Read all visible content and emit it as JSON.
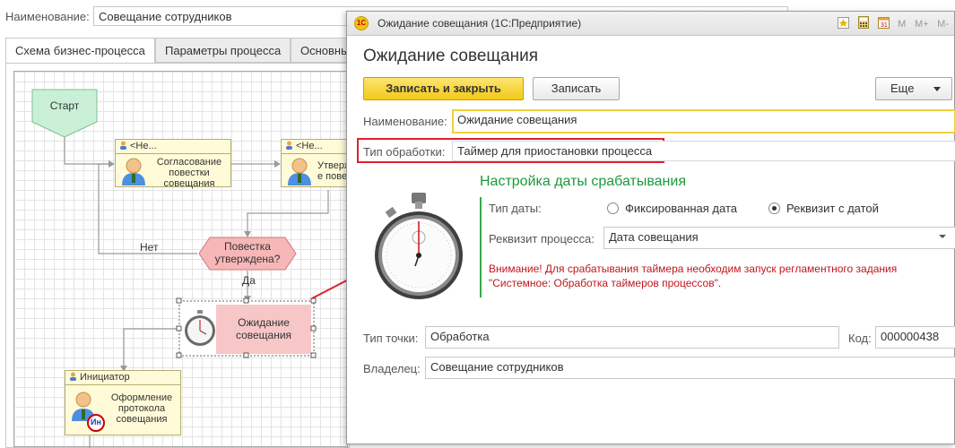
{
  "form": {
    "name_label": "Наименование:",
    "name_value": "Совещание сотрудников"
  },
  "tabs": [
    {
      "label": "Схема бизнес-процесса",
      "active": true
    },
    {
      "label": "Параметры процесса",
      "active": false
    },
    {
      "label": "Основны",
      "active": false
    }
  ],
  "diagram": {
    "start": "Старт",
    "task1_header": "<Не...",
    "task1_text": [
      "Согласование",
      "повестки",
      "совещания"
    ],
    "task2_header": "<Не...",
    "task2_text": [
      "Утверж",
      "е пове"
    ],
    "condition": [
      "Повестка",
      "утверждена?"
    ],
    "no_label": "Нет",
    "yes_label": "Да",
    "timer_text": [
      "Ожидание",
      "совещания"
    ],
    "task3_header": "Инициатор",
    "task3_text": [
      "Оформление",
      "протокола",
      "совещания"
    ],
    "badge": "Ин"
  },
  "dialog": {
    "window_title": "Ожидание совещания  (1С:Предприятие)",
    "heading": "Ожидание совещания",
    "save_close_label": "Записать и закрыть",
    "save_label": "Записать",
    "more_label": "Еще",
    "name_label": "Наименование:",
    "name_value": "Ожидание совещания",
    "processing_label": "Тип обработки:",
    "processing_value": "Таймер для приостановки процесса",
    "section_title": "Настройка даты срабатывания",
    "date_type_label": "Тип даты:",
    "radio_fixed": "Фиксированная дата",
    "radio_attr": "Реквизит с датой",
    "selected_radio": "Реквизит с датой",
    "attr_label": "Реквизит процесса:",
    "attr_value": "Дата совещания",
    "warning": "Внимание! Для срабатывания таймера необходим запуск регламентного задания \"Системное: Обработка таймеров процессов\".",
    "point_type_label": "Тип точки:",
    "point_type_value": "Обработка",
    "code_label": "Код:",
    "code_value": "000000438",
    "owner_label": "Владелец:",
    "owner_value": "Совещание сотрудников",
    "toolbar_icons": [
      "favorite-icon",
      "calculator-icon",
      "calendar-icon",
      "M",
      "M+",
      "M-"
    ]
  },
  "colors": {
    "accent_yellow": "#f2c916",
    "section_green": "#1a9a3a",
    "highlight_red": "#e0202f",
    "task_fill": "#fffbd8",
    "start_fill": "#c9f0d7",
    "condition_fill": "#f7b7b7"
  }
}
